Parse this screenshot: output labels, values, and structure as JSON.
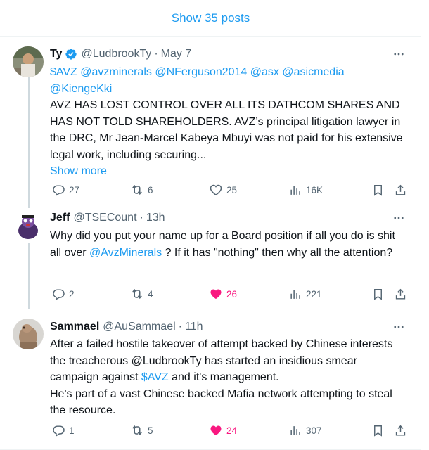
{
  "show_posts": {
    "label": "Show 35 posts"
  },
  "tweets": [
    {
      "name": "Ty",
      "handle": "@LudbrookTy",
      "dot": "·",
      "time": "May 7",
      "verified": true,
      "mentions_line": "$AVZ @avzminerals @NFerguson2014 @asx @asicmedia @KiengeKki",
      "mentions": [
        "$AVZ",
        "@avzminerals",
        "@NFerguson2014",
        "@asx",
        "@asicmedia",
        "@KiengeKki"
      ],
      "text": "AVZ HAS LOST CONTROL OVER ALL ITS DATHCOM SHARES AND HAS NOT TOLD SHAREHOLDERS. AVZ’s principal litigation lawyer in the DRC, Mr Jean-Marcel Kabeya Mbuyi was not paid for his extensive legal work, including securing...",
      "show_more": "Show more",
      "replies": "27",
      "reposts": "6",
      "likes": "25",
      "views": "16K"
    },
    {
      "name": "Jeff",
      "handle": "@TSECount",
      "dot": "·",
      "time": "13h",
      "text_before": "Why did you put your name up for a Board position if all you do is shit all over ",
      "link": "@AvzMinerals",
      "text_after": " ? If it has \"nothing\" then why all the attention?",
      "replies": "2",
      "reposts": "4",
      "likes": "26",
      "views": "221"
    },
    {
      "name": "Sammael",
      "handle": "@AuSammael",
      "dot": "·",
      "time": "11h",
      "text_before": "After a failed hostile takeover of attempt backed by Chinese interests the treacherous @LudbrookTy has started an insidious smear campaign against ",
      "link": "$AVZ",
      "text_after": " and it's management.",
      "text_line2": "He's part of a vast Chinese backed Mafia network attempting to steal the resource.",
      "replies": "1",
      "reposts": "5",
      "likes": "24",
      "views": "307"
    }
  ],
  "colors": {
    "accent": "#1d9bf0",
    "text": "#0f1419",
    "muted": "#536471",
    "like": "#f91880",
    "border": "#eff3f4"
  },
  "icons": [
    "verified-badge-icon",
    "more-icon",
    "reply-icon",
    "repost-icon",
    "like-icon",
    "views-icon",
    "bookmark-icon",
    "share-icon"
  ]
}
